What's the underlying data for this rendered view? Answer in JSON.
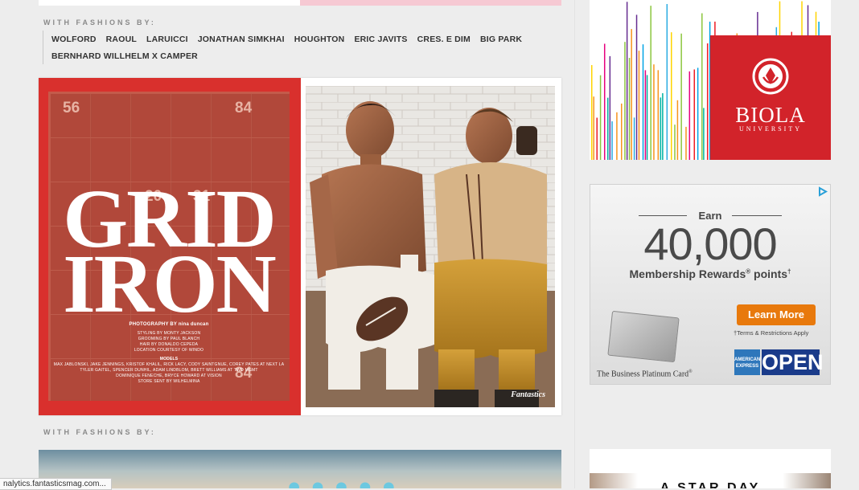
{
  "prev_fashions_label": "WITH FASHIONS BY:",
  "brands_row1": [
    "WOLFORD",
    "RAOUL",
    "LARUICCI",
    "JONATHAN SIMKHAI",
    "HOUGHTON",
    "ERIC JAVITS",
    "CRES. E DIM",
    "BIG PARK"
  ],
  "brands_row2": [
    "BERNHARD WILLHELM X CAMPER"
  ],
  "spread": {
    "title_line1": "GRID",
    "title_line2": "IRON",
    "credit_photo": "PHOTOGRAPHY BY nina duncan",
    "credit_lines": [
      "STYLING BY MONTY JACKSON",
      "GROOMING BY PAUL BLANCH",
      "HAIR BY DONALDO CEPEDA",
      "LOCATION COURTESY OF WINDO"
    ],
    "credit_models_head": "MODELS",
    "credit_models": [
      "MAX JABLONSKI, JAKE JENNINGS, KRISTOF KHALIL, RICK LACY, CODY SAINTGNUE, COREY PATES AT NEXT LA",
      "TYLER GAITEL, SPENCER DUNHIL, ADAM LINDBLOM, BRETT WILLIAMS AT TWO MGMT",
      "DOMINIQUE FENECHE, BRYCE HOWARD AT VISION",
      "STORE SENT BY WILHELMINA"
    ],
    "card_numbers": [
      "56",
      "84",
      "20",
      "31",
      "84"
    ],
    "magazine_logo": "Fantastics"
  },
  "next_fashions_label": "WITH FASHIONS BY:",
  "ads": {
    "biola": {
      "name": "BIOLA",
      "sub": "UNIVERSITY",
      "color": "#d2232a"
    },
    "amex": {
      "earn": "Earn",
      "amount": "40,000",
      "rewards": "Membership Rewards",
      "rewards_mark": "®",
      "points": " points",
      "points_mark": "†",
      "cta": "Learn More",
      "terms": "†Terms & Restrictions Apply",
      "card_caption": "The Business Platinum Card",
      "card_caption_mark": "®",
      "brand": "OPEN",
      "amex_line1": "AMERICAN",
      "amex_line2": "EXPRESS",
      "adchoices_icon": "adchoices-icon"
    },
    "third_ad_text": "A STAR DAY"
  },
  "status_bar": "nalytics.fantasticsmag.com...",
  "colors": {
    "accent_red": "#d9302d",
    "amex_blue": "#0072c6",
    "cta_orange": "#e8790c"
  }
}
